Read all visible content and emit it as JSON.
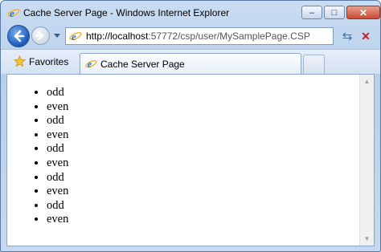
{
  "window": {
    "title": "Cache Server Page - Windows Internet Explorer",
    "controls": {
      "minimize": "–",
      "maximize": "□",
      "close": "✕"
    }
  },
  "navigation": {
    "address_host": "http://localhost",
    "address_rest": ":57772/csp/user/MySamplePage.CSP",
    "refresh_glyph": "⇆",
    "stop_glyph": "✕",
    "dropdown_glyph": "▼"
  },
  "favorites_bar": {
    "favorites_label": "Favorites",
    "tab_title": "Cache Server Page"
  },
  "page": {
    "items": [
      "odd",
      "even",
      "odd",
      "even",
      "odd",
      "even",
      "odd",
      "even",
      "odd",
      "even"
    ]
  },
  "scrollbar": {
    "up_glyph": "▲",
    "down_glyph": "▼"
  },
  "colors": {
    "accent": "#1f5fbf",
    "chrome": "#c9dcf2",
    "close": "#c74b33"
  }
}
